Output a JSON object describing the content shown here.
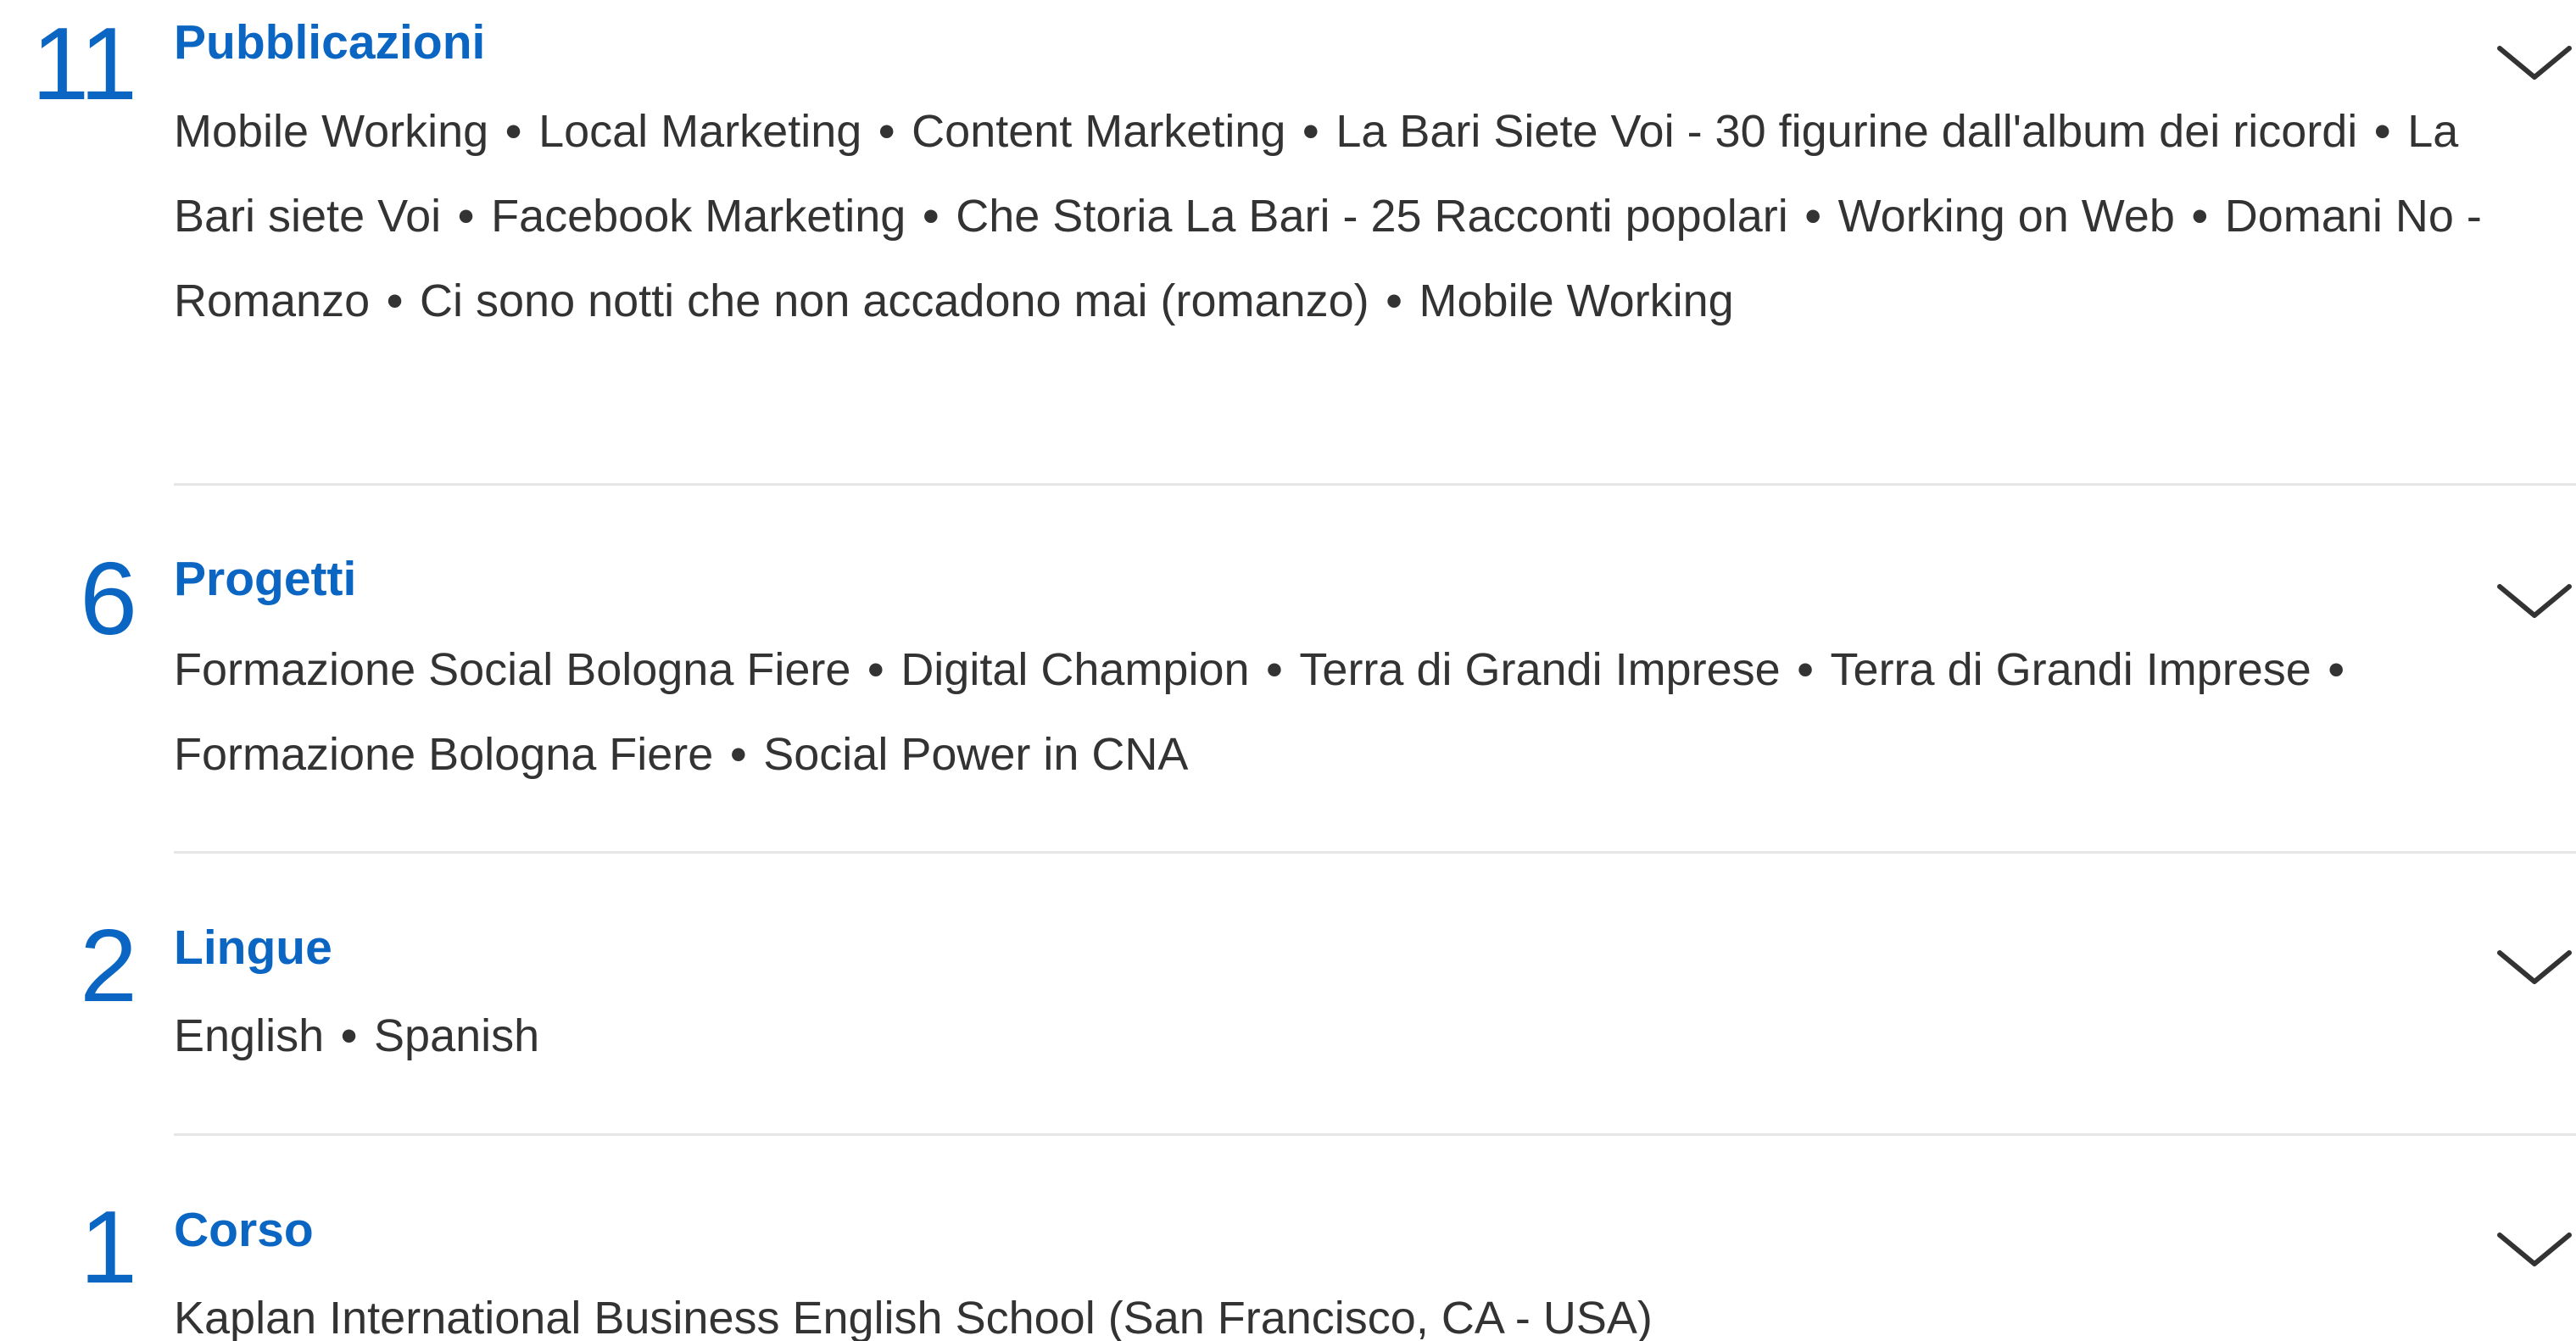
{
  "sections": [
    {
      "count": "11",
      "title": "Pubblicazioni",
      "items": [
        "Mobile Working",
        "Local Marketing",
        "Content Marketing",
        "La Bari Siete Voi - 30 figurine dall'album dei ricordi",
        "La Bari siete Voi",
        "Facebook Marketing",
        "Che Storia La Bari - 25 Racconti popolari",
        "Working on Web",
        "Domani No - Romanzo",
        "Ci sono notti che non accadono mai (romanzo)",
        "Mobile Working"
      ],
      "chevron_icon": "chevron-down-icon"
    },
    {
      "count": "6",
      "title": "Progetti",
      "items": [
        "Formazione Social Bologna Fiere",
        "Digital Champion",
        "Terra di Grandi Imprese",
        "Terra di Grandi Imprese",
        "Formazione Bologna Fiere",
        "Social Power in CNA"
      ],
      "chevron_icon": "chevron-down-icon"
    },
    {
      "count": "2",
      "title": "Lingue",
      "items": [
        "English",
        "Spanish"
      ],
      "chevron_icon": "chevron-down-icon"
    },
    {
      "count": "1",
      "title": "Corso",
      "items": [
        "Kaplan International Business English School (San Francisco, CA - USA)"
      ],
      "chevron_icon": "chevron-down-icon"
    }
  ],
  "colors": {
    "accent": "#0a66c2",
    "text": "#333333",
    "divider": "#e6e6e6"
  }
}
